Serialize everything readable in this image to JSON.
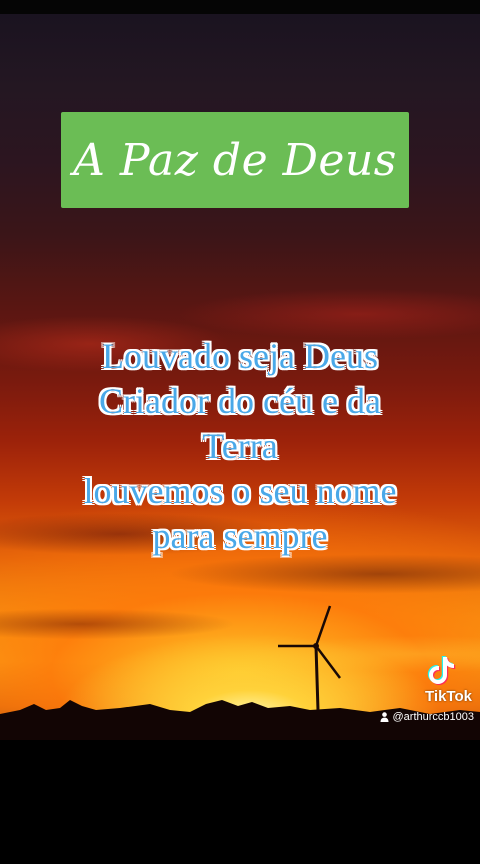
{
  "title": "A Paz de Deus",
  "verse_lines": [
    "Louvado seja Deus",
    "Criador do céu e da",
    "Terra",
    "louvemos o seu nome",
    "para sempre"
  ],
  "watermark": {
    "brand": "TikTok",
    "username": "@arthurccb1003",
    "logo_icon": "tiktok-icon",
    "user_icon": "person-icon"
  },
  "colors": {
    "title_box": "#6bbd55",
    "verse_fill": "#4aa8e8",
    "verse_outline": "#ffffff"
  }
}
